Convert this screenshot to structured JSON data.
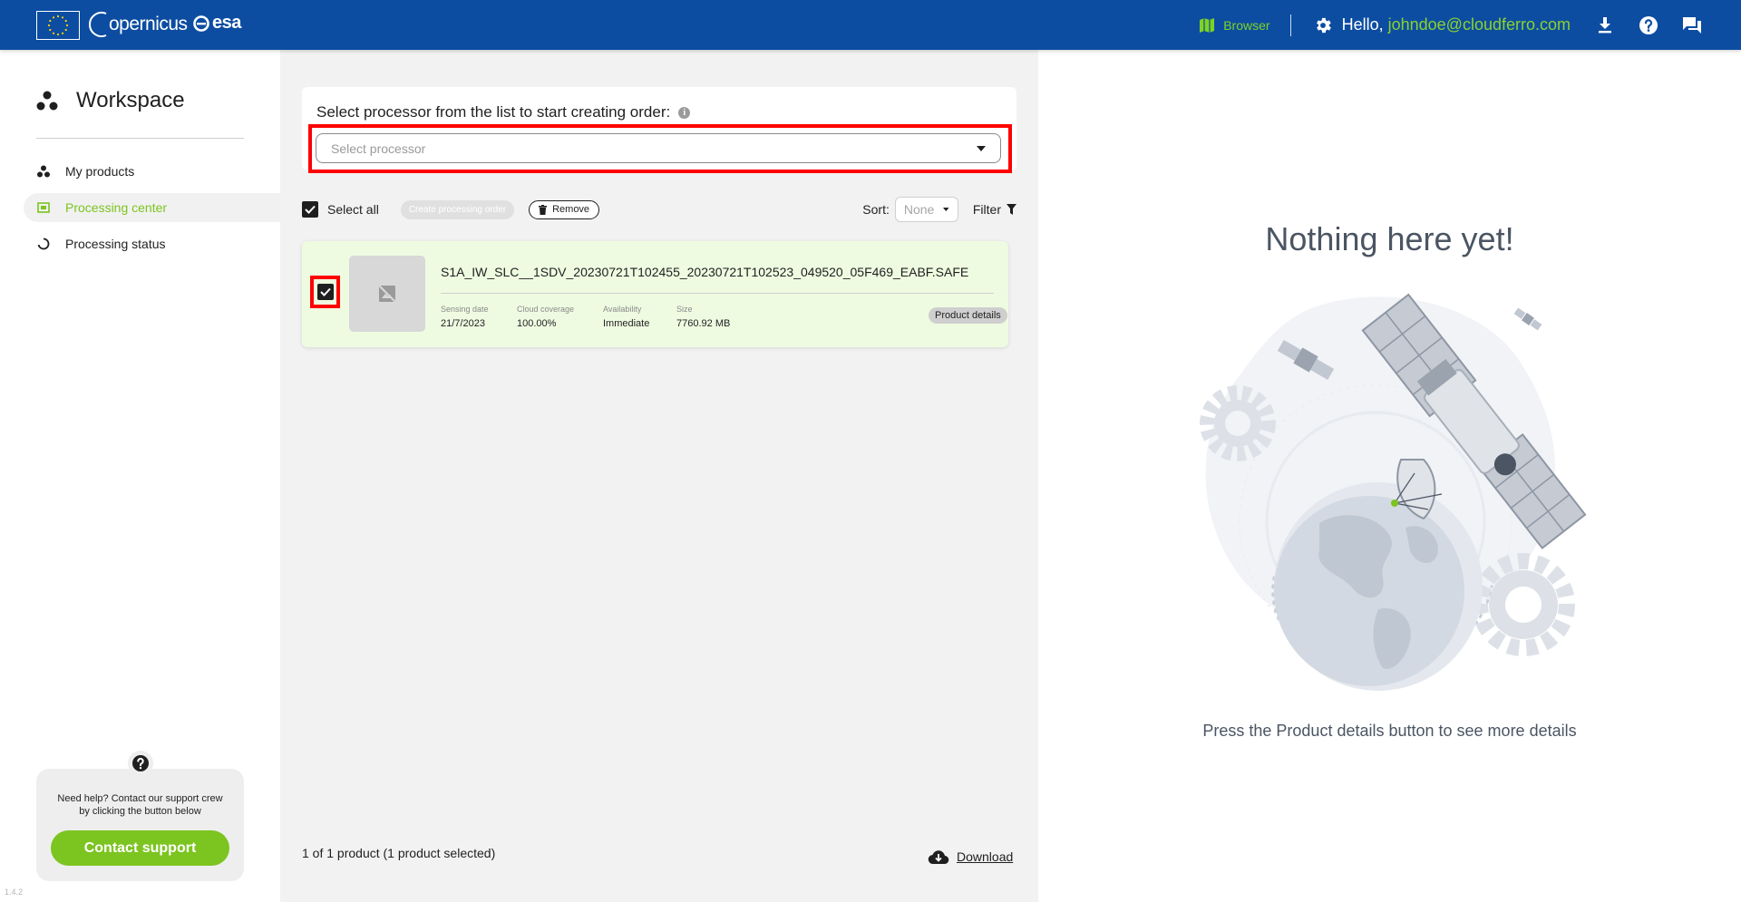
{
  "header": {
    "brand_copernicus": "opernicus",
    "brand_esa": "esa",
    "browser_label": "Browser",
    "greeting_prefix": "Hello, ",
    "user_email": "johndoe@cloudferro.com",
    "colors": {
      "topbar": "#0c4da2",
      "accent_green": "#7ed321"
    }
  },
  "sidebar": {
    "title": "Workspace",
    "items": [
      {
        "label": "My products",
        "icon": "products-icon",
        "active": false
      },
      {
        "label": "Processing center",
        "icon": "processing-center-icon",
        "active": true
      },
      {
        "label": "Processing status",
        "icon": "processing-status-icon",
        "active": false
      }
    ],
    "help": {
      "text": "Need help? Contact our support crew by clicking the button below",
      "button_label": "Contact support"
    },
    "version": "1.4.2"
  },
  "main": {
    "select_title": "Select processor from the list to start creating order:",
    "select_placeholder": "Select processor",
    "select_all_label": "Select all",
    "select_all_checked": true,
    "create_order_label": "Create processing order",
    "remove_label": "Remove",
    "sort_label": "Sort:",
    "sort_value": "None",
    "filter_label": "Filter",
    "products": [
      {
        "name": "S1A_IW_SLC__1SDV_20230721T102455_20230721T102523_049520_05F469_EABF.SAFE",
        "checked": true,
        "meta": [
          {
            "label": "Sensing date",
            "value": "21/7/2023"
          },
          {
            "label": "Cloud coverage",
            "value": "100.00%"
          },
          {
            "label": "Availability",
            "value": "Immediate"
          },
          {
            "label": "Size",
            "value": "7760.92 MB"
          }
        ],
        "details_label": "Product details"
      }
    ],
    "footer_count": "1 of 1 product (1 product selected)",
    "download_label": "Download"
  },
  "right_panel": {
    "title": "Nothing here yet!",
    "subtitle": "Press the Product details button to see more details"
  }
}
